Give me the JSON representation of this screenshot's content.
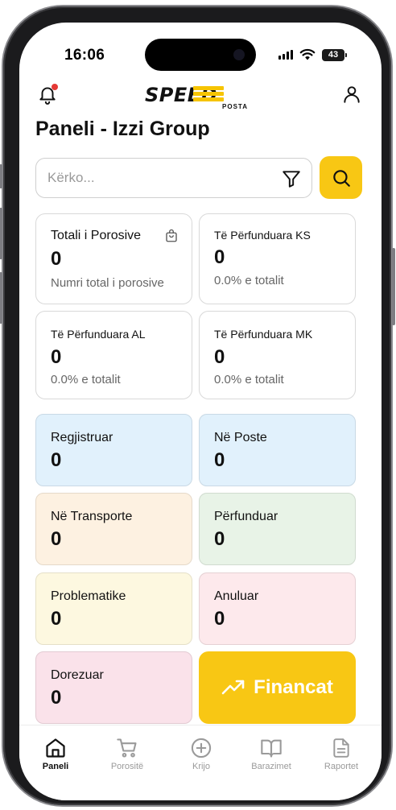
{
  "status_bar": {
    "time": "16:06",
    "battery": "43"
  },
  "header": {
    "logo_text": "SPEED",
    "logo_sub": "POSTA",
    "title": "Paneli - Izzi Group"
  },
  "search": {
    "placeholder": "Kërko..."
  },
  "stats": [
    {
      "label": "Totali i Porosive",
      "value": "0",
      "sub": "Numri total i porosive"
    },
    {
      "label": "Të Përfunduara KS",
      "value": "0",
      "sub": "0.0% e totalit"
    },
    {
      "label": "Të Përfunduara AL",
      "value": "0",
      "sub": "0.0% e totalit"
    },
    {
      "label": "Të Përfunduara MK",
      "value": "0",
      "sub": "0.0% e totalit"
    }
  ],
  "statuses": [
    {
      "label": "Regjistruar",
      "value": "0",
      "color": "#e1f1fc"
    },
    {
      "label": "Në Poste",
      "value": "0",
      "color": "#e1f1fc"
    },
    {
      "label": "Në Transporte",
      "value": "0",
      "color": "#fdf1e1"
    },
    {
      "label": "Përfunduar",
      "value": "0",
      "color": "#e8f3e7"
    },
    {
      "label": "Problematike",
      "value": "0",
      "color": "#fdf8e0"
    },
    {
      "label": "Anuluar",
      "value": "0",
      "color": "#fde9ec"
    },
    {
      "label": "Dorezuar",
      "value": "0",
      "color": "#fae2ea"
    }
  ],
  "finance_button": {
    "label": "Financat",
    "icon": "trending-up-icon",
    "color": "#f8c714"
  },
  "nav": [
    {
      "label": "Paneli",
      "icon": "home-icon",
      "active": true
    },
    {
      "label": "Porositë",
      "icon": "cart-icon",
      "active": false
    },
    {
      "label": "Krijo",
      "icon": "plus-circle-icon",
      "active": false
    },
    {
      "label": "Barazimet",
      "icon": "book-icon",
      "active": false
    },
    {
      "label": "Raportet",
      "icon": "document-icon",
      "active": false
    }
  ],
  "colors": {
    "accent": "#f8c714",
    "notification_dot": "#e53935"
  }
}
